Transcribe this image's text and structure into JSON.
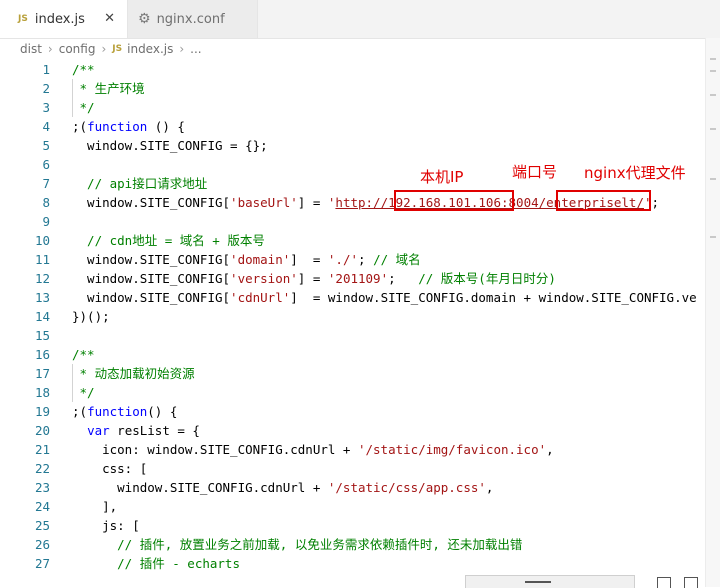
{
  "tabs": [
    {
      "label": "index.js",
      "badge": "JS",
      "close": "✕"
    },
    {
      "label": "nginx.conf"
    }
  ],
  "breadcrumb": {
    "items": [
      "dist",
      "config"
    ],
    "file_badge": "JS",
    "file": "index.js",
    "more": "..."
  },
  "editor": {
    "line_numbers": [
      "1",
      "2",
      "3",
      "4",
      "5",
      "6",
      "7",
      "8",
      "9",
      "10",
      "11",
      "12",
      "13",
      "14",
      "15",
      "16",
      "17",
      "18",
      "19",
      "20",
      "21",
      "22",
      "23",
      "24",
      "25",
      "26",
      "27"
    ],
    "lines": [
      [
        {
          "t": "/**",
          "c": "c"
        }
      ],
      [
        {
          "t": " * 生产环境",
          "c": "c"
        }
      ],
      [
        {
          "t": " */",
          "c": "c"
        }
      ],
      [
        {
          "t": ";(",
          "c": ""
        },
        {
          "t": "function",
          "c": "k"
        },
        {
          "t": " () {",
          "c": ""
        }
      ],
      [
        {
          "t": "  window.SITE_CONFIG = {};",
          "c": ""
        }
      ],
      [],
      [
        {
          "t": "  // api接口请求地址",
          "c": "c"
        }
      ],
      [
        {
          "t": "  window.SITE_CONFIG[",
          "c": ""
        },
        {
          "t": "'baseUrl'",
          "c": "s"
        },
        {
          "t": "] = ",
          "c": ""
        },
        {
          "t": "'",
          "c": "s"
        },
        {
          "t": "http://192.168.101.106:8004/enterpriselt/",
          "c": "s u"
        },
        {
          "t": "'",
          "c": "s"
        },
        {
          "t": ";",
          "c": ""
        }
      ],
      [],
      [
        {
          "t": "  // cdn地址 = 域名 + 版本号",
          "c": "c"
        }
      ],
      [
        {
          "t": "  window.SITE_CONFIG[",
          "c": ""
        },
        {
          "t": "'domain'",
          "c": "s"
        },
        {
          "t": "]  = ",
          "c": ""
        },
        {
          "t": "'./'",
          "c": "s"
        },
        {
          "t": "; ",
          "c": ""
        },
        {
          "t": "// 域名",
          "c": "c"
        }
      ],
      [
        {
          "t": "  window.SITE_CONFIG[",
          "c": ""
        },
        {
          "t": "'version'",
          "c": "s"
        },
        {
          "t": "] = ",
          "c": ""
        },
        {
          "t": "'201109'",
          "c": "s"
        },
        {
          "t": ";   ",
          "c": ""
        },
        {
          "t": "// 版本号(年月日时分)",
          "c": "c"
        }
      ],
      [
        {
          "t": "  window.SITE_CONFIG[",
          "c": ""
        },
        {
          "t": "'cdnUrl'",
          "c": "s"
        },
        {
          "t": "]  = window.SITE_CONFIG.domain + window.SITE_CONFIG.ve",
          "c": ""
        }
      ],
      [
        {
          "t": "})();",
          "c": ""
        }
      ],
      [],
      [
        {
          "t": "/**",
          "c": "c"
        }
      ],
      [
        {
          "t": " * 动态加载初始资源",
          "c": "c"
        }
      ],
      [
        {
          "t": " */",
          "c": "c"
        }
      ],
      [
        {
          "t": ";(",
          "c": ""
        },
        {
          "t": "function",
          "c": "k"
        },
        {
          "t": "() {",
          "c": ""
        }
      ],
      [
        {
          "t": "  ",
          "c": ""
        },
        {
          "t": "var",
          "c": "k"
        },
        {
          "t": " resList = {",
          "c": ""
        }
      ],
      [
        {
          "t": "    icon: window.SITE_CONFIG.cdnUrl + ",
          "c": ""
        },
        {
          "t": "'/static/img/favicon.ico'",
          "c": "s"
        },
        {
          "t": ",",
          "c": ""
        }
      ],
      [
        {
          "t": "    css: [",
          "c": ""
        }
      ],
      [
        {
          "t": "      window.SITE_CONFIG.cdnUrl + ",
          "c": ""
        },
        {
          "t": "'/static/css/app.css'",
          "c": "s"
        },
        {
          "t": ",",
          "c": ""
        }
      ],
      [
        {
          "t": "    ],",
          "c": ""
        }
      ],
      [
        {
          "t": "    js: [",
          "c": ""
        }
      ],
      [
        {
          "t": "      // 插件, 放置业务之前加载, 以免业务需求依赖插件时, 还未加载出错",
          "c": "c"
        }
      ],
      [
        {
          "t": "      // 插件 - echarts",
          "c": "c"
        }
      ]
    ]
  },
  "annotations": {
    "local_ip": "本机IP",
    "port": "端口号",
    "nginx_proxy": "nginx代理文件"
  },
  "colors": {
    "comment": "#008000",
    "keyword": "#0000ff",
    "string": "#a31515",
    "annotation": "#e00000",
    "line_number": "#237893"
  }
}
